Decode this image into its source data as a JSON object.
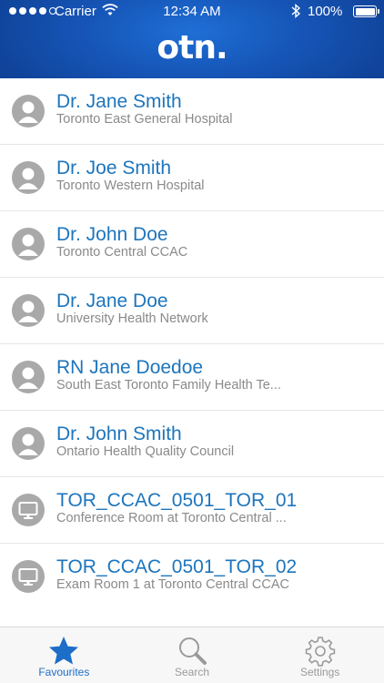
{
  "status_bar": {
    "carrier": "Carrier",
    "time": "12:34 AM",
    "battery": "100%"
  },
  "header": {
    "logo_text": "otn."
  },
  "contacts": [
    {
      "name": "Dr. Jane Smith",
      "subtitle": "Toronto East General Hospital",
      "icon": "person-icon"
    },
    {
      "name": "Dr. Joe Smith",
      "subtitle": "Toronto Western Hospital",
      "icon": "person-icon"
    },
    {
      "name": "Dr. John Doe",
      "subtitle": "Toronto Central CCAC",
      "icon": "person-icon"
    },
    {
      "name": "Dr. Jane Doe",
      "subtitle": "University Health Network",
      "icon": "person-icon"
    },
    {
      "name": "RN Jane Doedoe",
      "subtitle": "South East Toronto Family Health Te...",
      "icon": "person-icon"
    },
    {
      "name": "Dr. John Smith",
      "subtitle": "Ontario Health Quality Council",
      "icon": "person-icon"
    },
    {
      "name": "TOR_CCAC_0501_TOR_01",
      "subtitle": "Conference Room at Toronto Central ...",
      "icon": "monitor-icon"
    },
    {
      "name": "TOR_CCAC_0501_TOR_02",
      "subtitle": "Exam Room 1 at Toronto Central CCAC",
      "icon": "monitor-icon"
    }
  ],
  "tabbar": {
    "tabs": [
      {
        "label": "Favourites",
        "icon": "star-icon",
        "active": true
      },
      {
        "label": "Search",
        "icon": "search-icon",
        "active": false
      },
      {
        "label": "Settings",
        "icon": "gear-icon",
        "active": false
      }
    ]
  },
  "colors": {
    "header_blue": "#1656b8",
    "name_blue": "#1d75bd",
    "tab_active": "#1d6ec7",
    "tab_inactive": "#9a9a9a"
  }
}
